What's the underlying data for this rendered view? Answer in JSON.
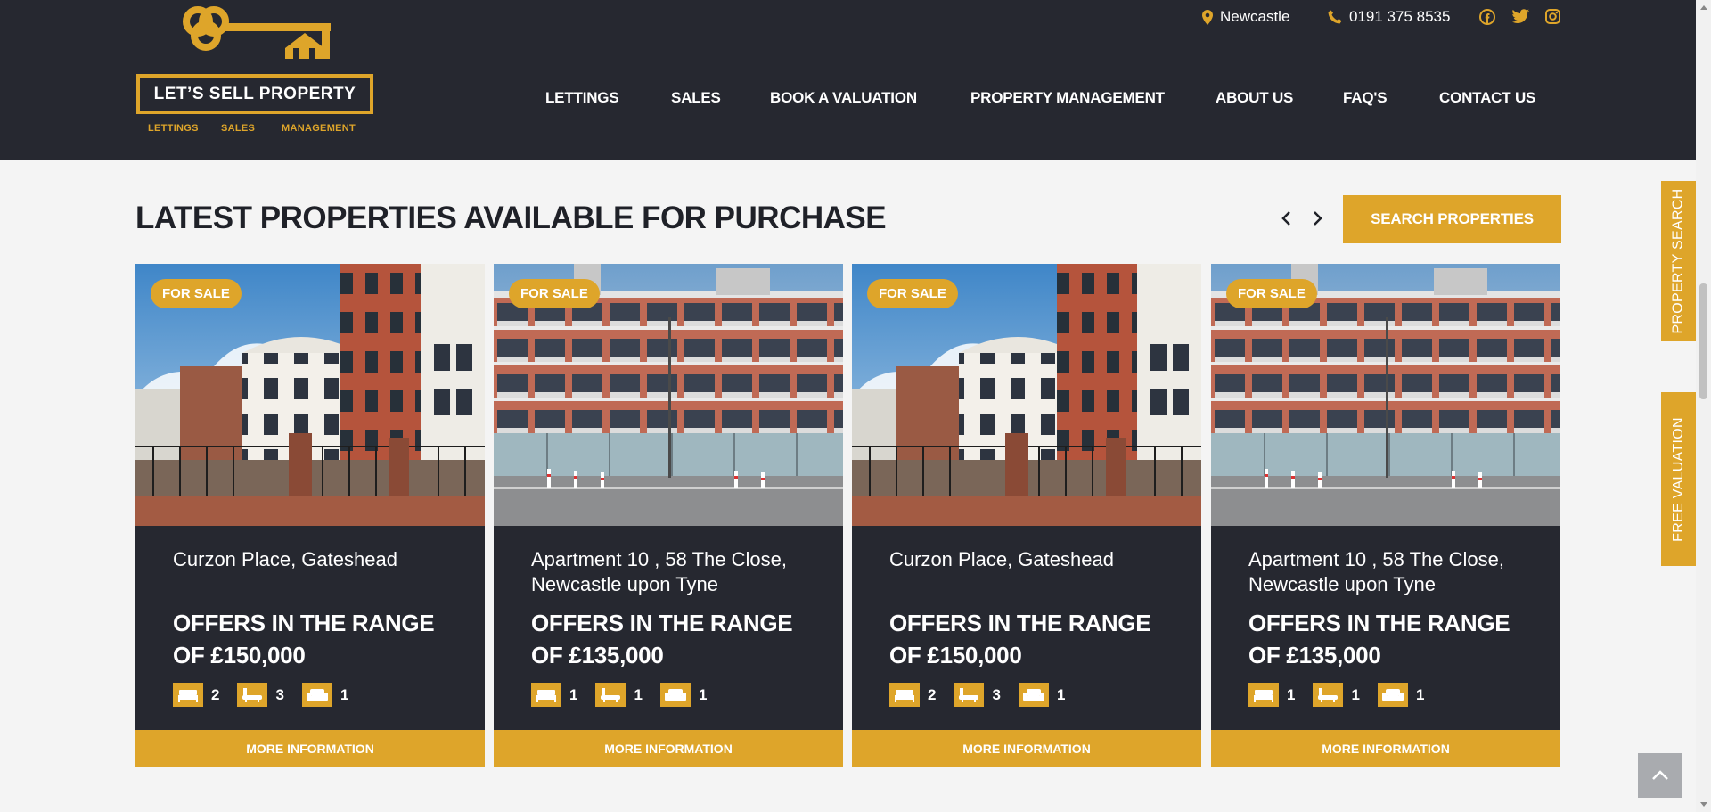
{
  "colors": {
    "accent": "#dea52a",
    "dark": "#262830",
    "background": "#f4f4f4"
  },
  "brand": {
    "name": "LET’S  SELL  PROPERTY",
    "sub": [
      "LETTINGS",
      "SALES",
      "MANAGEMENT"
    ]
  },
  "topbar": {
    "location": "Newcastle",
    "phone": "0191 375 8535",
    "social_icons": [
      "facebook-icon",
      "twitter-icon",
      "instagram-icon"
    ]
  },
  "nav": [
    "LETTINGS",
    "SALES",
    "BOOK A VALUATION",
    "PROPERTY MANAGEMENT",
    "ABOUT US",
    "FAQ'S",
    "CONTACT US"
  ],
  "section": {
    "title": "LATEST PROPERTIES AVAILABLE FOR PURCHASE",
    "search_button": "SEARCH PROPERTIES"
  },
  "properties": [
    {
      "badge": "FOR SALE",
      "address": "Curzon Place, Gateshead",
      "price": "OFFERS IN THE RANGE OF £150,000",
      "bedrooms": "2",
      "bathrooms": "3",
      "receptions": "1",
      "button": "MORE INFORMATION"
    },
    {
      "badge": "FOR SALE",
      "address": "Apartment 10 , 58 The Close, Newcastle upon Tyne",
      "price": "OFFERS IN THE RANGE OF £135,000",
      "bedrooms": "1",
      "bathrooms": "1",
      "receptions": "1",
      "button": "MORE INFORMATION"
    },
    {
      "badge": "FOR SALE",
      "address": "Curzon Place, Gateshead",
      "price": "OFFERS IN THE RANGE OF £150,000",
      "bedrooms": "2",
      "bathrooms": "3",
      "receptions": "1",
      "button": "MORE INFORMATION"
    },
    {
      "badge": "FOR SALE",
      "address": "Apartment 10 , 58 The Close, Newcastle upon Tyne",
      "price": "OFFERS IN THE RANGE OF £135,000",
      "bedrooms": "1",
      "bathrooms": "1",
      "receptions": "1",
      "button": "MORE INFORMATION"
    }
  ],
  "side_tabs": [
    "PROPERTY SEARCH",
    "FREE VALUATION"
  ]
}
